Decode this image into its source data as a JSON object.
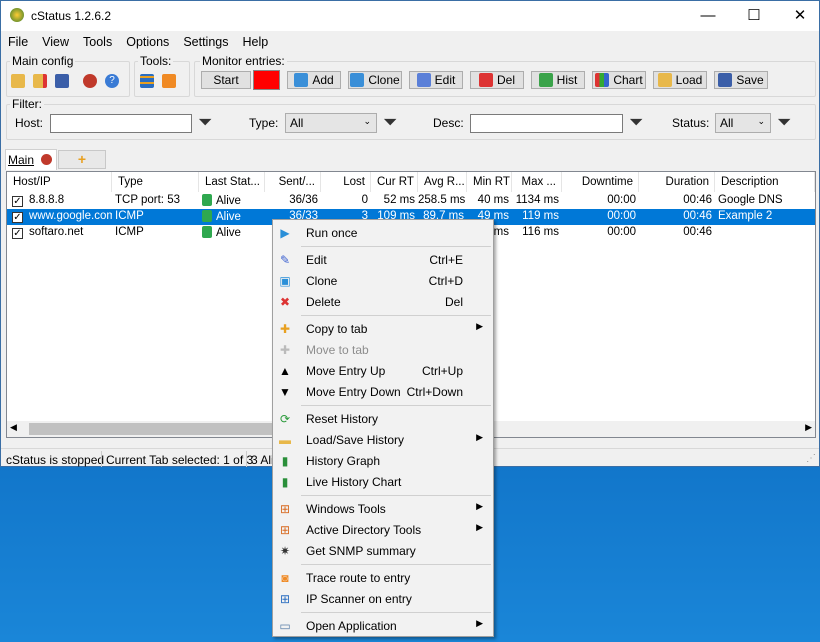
{
  "window": {
    "title": "cStatus 1.2.6.2",
    "minimize": "—",
    "maximize": "☐",
    "close": "✕"
  },
  "menu": [
    "File",
    "View",
    "Tools",
    "Options",
    "Settings",
    "Help"
  ],
  "toolbar": {
    "main_config": "Main config",
    "tools": "Tools:",
    "monitor_entries": "Monitor entries:",
    "start": "Start",
    "status_color": "#ff0000",
    "add": "Add",
    "clone": "Clone",
    "edit": "Edit",
    "del": "Del",
    "hist": "Hist",
    "chart": "Chart",
    "load": "Load",
    "save": "Save"
  },
  "filter": {
    "label": "Filter:",
    "host_label": "Host:",
    "host_value": "",
    "type_label": "Type:",
    "type_value": "All",
    "desc_label": "Desc:",
    "desc_value": "",
    "status_label": "Status:",
    "status_value": "All"
  },
  "tabs": {
    "main": "Main",
    "add": "+"
  },
  "list": {
    "headers": [
      "Host/IP",
      "Type",
      "Last Stat...",
      "Sent/...",
      "Lost",
      "Cur RT",
      "Avg R...",
      "Min RT",
      "Max ...",
      "Downtime",
      "Duration",
      "Description"
    ],
    "rows": [
      {
        "host": "8.8.8.8",
        "type": "TCP port: 53",
        "status": "Alive",
        "sent": "36/36",
        "lost": "0",
        "cur": "52 ms",
        "avg": "258.5 ms",
        "min": "40 ms",
        "max": "1134 ms",
        "down": "00:00",
        "dur": "00:46",
        "desc": "Google DNS",
        "checked": true,
        "selected": false
      },
      {
        "host": "www.google.com",
        "type": "ICMP",
        "status": "Alive",
        "sent": "36/33",
        "lost": "3",
        "cur": "109 ms",
        "avg": "89.7 ms",
        "min": "49 ms",
        "max": "119 ms",
        "down": "00:00",
        "dur": "00:46",
        "desc": "Example 2",
        "checked": true,
        "selected": true
      },
      {
        "host": "softaro.net",
        "type": "ICMP",
        "status": "Alive",
        "sent": "",
        "lost": "",
        "cur": "",
        "avg": "",
        "min": "ms",
        "max": "116 ms",
        "down": "00:00",
        "dur": "00:46",
        "desc": "",
        "checked": true,
        "selected": false
      }
    ]
  },
  "statusbar": {
    "state": "cStatus is stopped",
    "tab": "Current Tab selected: 1 of 3",
    "alive": "3 Ali"
  },
  "context_menu": [
    {
      "label": "Run once",
      "icon": "run-icon"
    },
    {
      "sep": true
    },
    {
      "label": "Edit",
      "shortcut": "Ctrl+E",
      "icon": "edit-icon"
    },
    {
      "label": "Clone",
      "shortcut": "Ctrl+D",
      "icon": "clone-icon"
    },
    {
      "label": "Delete",
      "shortcut": "Del",
      "icon": "delete-icon"
    },
    {
      "sep": true
    },
    {
      "label": "Copy to tab",
      "submenu": true,
      "icon": "plus-icon"
    },
    {
      "label": "Move to tab",
      "disabled": true,
      "icon": "plus-icon"
    },
    {
      "label": "Move Entry Up",
      "shortcut": "Ctrl+Up",
      "icon": "up-arrow-icon"
    },
    {
      "label": "Move Entry Down",
      "shortcut": "Ctrl+Down",
      "icon": "down-arrow-icon"
    },
    {
      "sep": true
    },
    {
      "label": "Reset History",
      "icon": "reset-icon"
    },
    {
      "label": "Load/Save History",
      "submenu": true,
      "icon": "folder-icon"
    },
    {
      "label": "History Graph",
      "icon": "chart-icon"
    },
    {
      "label": "Live History Chart",
      "icon": "chart-icon"
    },
    {
      "sep": true
    },
    {
      "label": "Windows Tools",
      "submenu": true,
      "icon": "windows-icon"
    },
    {
      "label": "Active Directory Tools",
      "submenu": true,
      "icon": "windows-icon"
    },
    {
      "label": "Get SNMP summary",
      "icon": "gear-icon"
    },
    {
      "sep": true
    },
    {
      "label": "Trace route to entry",
      "icon": "rss-icon"
    },
    {
      "label": "IP Scanner on entry",
      "icon": "network-icon"
    },
    {
      "sep": true
    },
    {
      "label": "Open Application",
      "submenu": true,
      "icon": "application-icon"
    }
  ]
}
